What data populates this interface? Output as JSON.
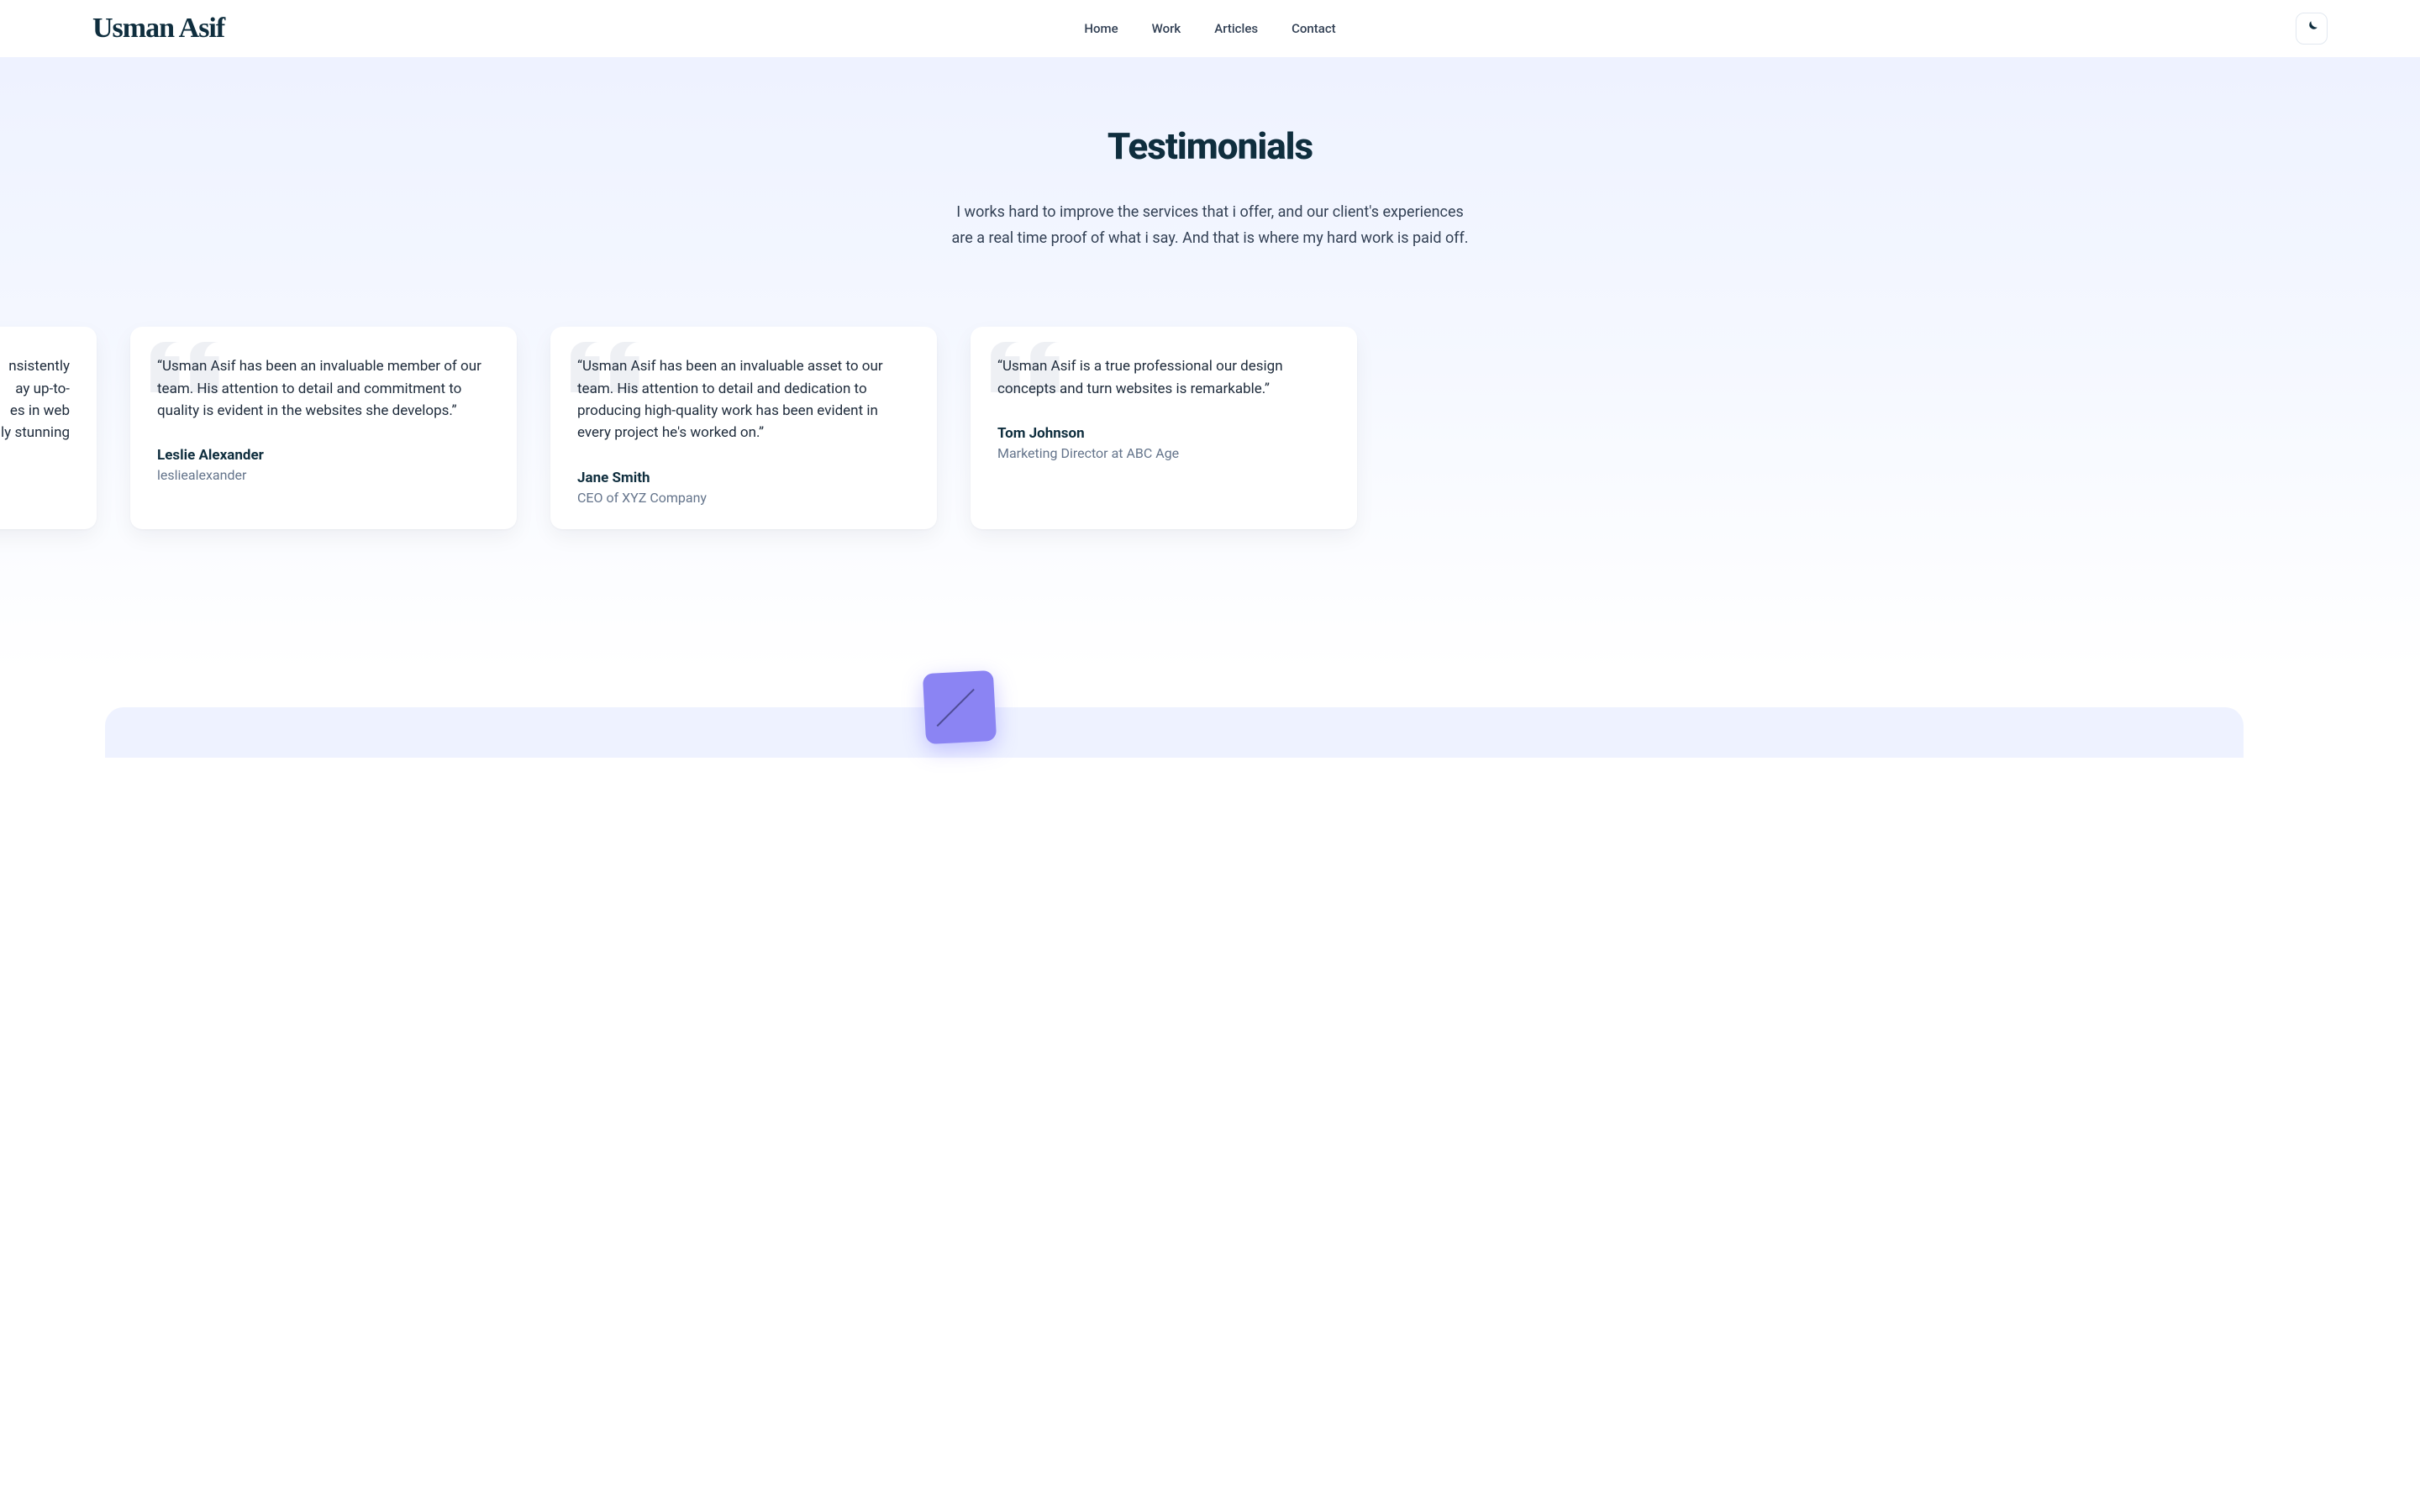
{
  "header": {
    "logo": "Usman Asif",
    "nav": [
      "Home",
      "Work",
      "Articles",
      "Contact"
    ]
  },
  "section": {
    "title": "Testimonials",
    "subtitle": "I works hard to improve the services that i offer, and our client's experiences are a real time proof of what i say. And that is where my hard work is paid off."
  },
  "testimonials": [
    {
      "quote_visible": "nsistently\nay up-to-\nes in web\nally stunning",
      "name": "",
      "role": ""
    },
    {
      "quote": "“Usman Asif has been an invaluable member of our team. His attention to detail and commitment to quality is evident in the websites she develops.”",
      "name": "Leslie Alexander",
      "role": "lesliealexander"
    },
    {
      "quote": "“Usman Asif has been an invaluable asset to our team. His attention to detail and dedication to producing high-quality work has been evident in every project he's worked on.”",
      "name": "Jane Smith",
      "role": "CEO of XYZ Company"
    },
    {
      "quote": "“Usman Asif is a true professional our design concepts and turn websites is remarkable.”",
      "name": "Tom Johnson",
      "role": "Marketing Director at ABC Age"
    }
  ],
  "icons": {
    "theme": "moon-icon"
  }
}
